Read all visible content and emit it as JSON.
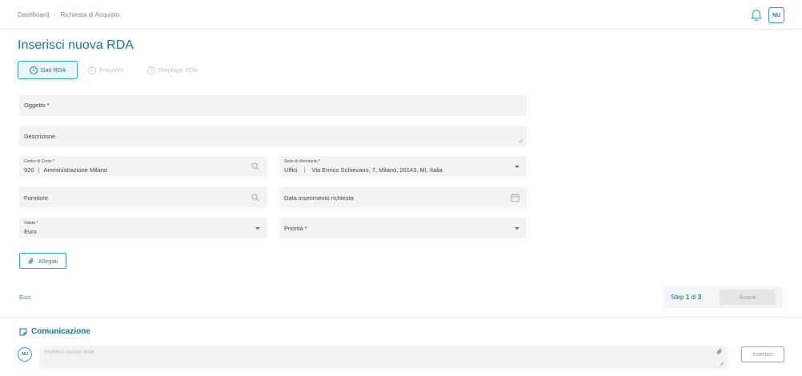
{
  "breadcrumb": {
    "items": [
      "Dashboard",
      "Richiesta di Acquisto"
    ],
    "separator": "›"
  },
  "header": {
    "user_initials": "NU",
    "bell_icon": "bell-icon"
  },
  "page": {
    "title": "Inserisci nuova RDA"
  },
  "stepper": {
    "steps": [
      {
        "number": "1",
        "label": "Dati RDA",
        "active": true
      },
      {
        "number": "2",
        "label": "Posizioni",
        "active": false
      },
      {
        "number": "3",
        "label": "Riepilogo RDA",
        "active": false
      }
    ]
  },
  "form": {
    "oggetto": {
      "label": "Oggetto *"
    },
    "descrizione": {
      "label": "Descrizione"
    },
    "centro_costo": {
      "label": "Centro di Costo *",
      "code": "920",
      "name": "Amministrazione Milano"
    },
    "sede": {
      "label": "Sede di riferimento *",
      "type": "Uffici",
      "address": "Via Enrico Schievano, 7, Milano, 20143, MI, Italia"
    },
    "fornitore": {
      "label": "Fornitore"
    },
    "data_inserimento": {
      "label": "Data inserimento richiesta"
    },
    "valuta": {
      "label": "Valuta *",
      "value": "Euro"
    },
    "priorita": {
      "label": "Priorità *"
    },
    "allegati_label": "Allegati"
  },
  "footer": {
    "esci_label": "Esci",
    "step_prefix": "Step",
    "step_current": "1",
    "step_middle": "di",
    "step_total": "3",
    "avanti_label": "Avanti"
  },
  "comunicazione": {
    "title": "Comunicazione",
    "user_initials": "NU",
    "note_placeholder": "Inserisci nuova nota",
    "inserisci_label": "Inserisci"
  },
  "colors": {
    "accent": "#1a6e8a",
    "border_accent": "#2aa0bb",
    "field_bg": "#f1f3f4"
  }
}
